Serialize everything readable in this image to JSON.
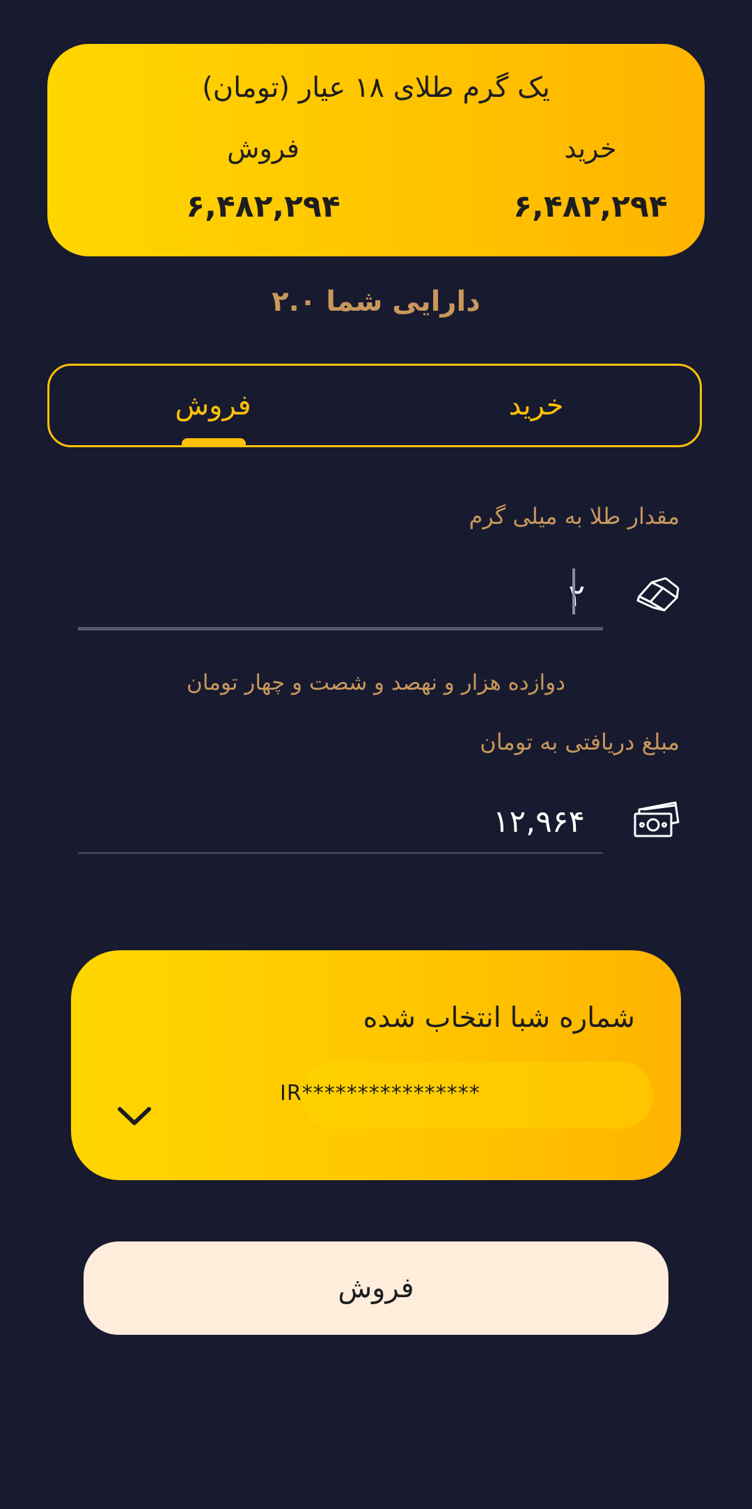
{
  "price_card": {
    "title": "یک گرم طلای ۱۸ عیار (تومان)",
    "buy_label": "خرید",
    "buy_value": "۶,۴۸۲,۲۹۴",
    "sell_label": "فروش",
    "sell_value": "۶,۴۸۲,۲۹۴"
  },
  "balance_text": "دارایی شما ۲.۰",
  "tabs": {
    "buy": "خرید",
    "sell": "فروش",
    "selected": "sell"
  },
  "gold_field": {
    "label": "مقدار طلا به میلی گرم",
    "value": "۲"
  },
  "amount_words": "دوازده هزار و نهصد و شصت و چهار تومان",
  "amount_field": {
    "label": "مبلغ دریافتی به تومان",
    "value": "۱۲,۹۶۴"
  },
  "iban": {
    "title": "شماره شبا انتخاب شده",
    "number": "IR****************"
  },
  "submit_label": "فروش",
  "colors": {
    "background": "#181a2f",
    "accent": "#ffc107",
    "label": "#c8985c",
    "button": "#ffeddc"
  },
  "icons": {
    "gold": "gold-bar-icon",
    "cash": "cash-icon",
    "dropdown": "chevron-down-icon"
  }
}
